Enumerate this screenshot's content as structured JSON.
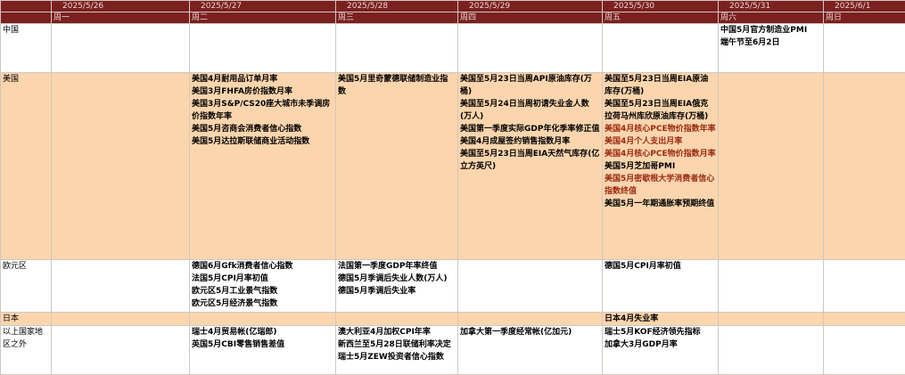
{
  "dates": [
    "2025/5/26",
    "2025/5/27",
    "2025/5/28",
    "2025/5/29",
    "2025/5/30",
    "2025/5/31",
    "2025/6/1"
  ],
  "weekdays": [
    "周一",
    "周二",
    "周三",
    "周四",
    "周五",
    "周六",
    "周日"
  ],
  "rows": [
    {
      "region": "中国",
      "cells": [
        [],
        [],
        [],
        [],
        [],
        [
          {
            "t": "中国5月官方制造业PMI"
          },
          {
            "t": "端午节至6月2日"
          }
        ],
        []
      ]
    },
    {
      "region": "美国",
      "cells": [
        [],
        [
          {
            "t": "美国4月耐用品订单月率"
          },
          {
            "t": "美国3月FHFA房价指数月率"
          },
          {
            "t": "美国3月S&P/CS20座大城市未季调房价指数年率"
          },
          {
            "t": "美国5月咨商会消费者信心指数"
          },
          {
            "t": "美国5月达拉斯联储商业活动指数"
          }
        ],
        [
          {
            "t": "美国5月里奇蒙德联储制造业指数"
          }
        ],
        [
          {
            "t": "美国至5月23日当周API原油库存(万桶)"
          },
          {
            "t": "美国至5月24日当周初请失业金人数(万人)"
          },
          {
            "t": "美国第一季度实际GDP年化季率修正值"
          },
          {
            "t": "美国4月成屋签约销售指数月率"
          },
          {
            "t": "美国至5月23日当周EIA天然气库存(亿立方英尺)"
          }
        ],
        [
          {
            "t": "美国至5月23日当周EIA原油库存(万桶)"
          },
          {
            "t": "美国至5月23日当周EIA俄克拉荷马州库欣原油库存(万桶)"
          },
          {
            "t": "美国4月核心PCE物价指数年率",
            "hl": true
          },
          {
            "t": "美国4月个人支出月率",
            "hl": true
          },
          {
            "t": "美国4月核心PCE物价指数月率",
            "hl": true
          },
          {
            "t": "美国5月芝加哥PMI"
          },
          {
            "t": "美国5月密歇根大学消费者信心指数终值",
            "hl": true
          },
          {
            "t": "美国5月一年期通胀率预期终值"
          }
        ],
        [],
        []
      ]
    },
    {
      "region": "欧元区",
      "cells": [
        [],
        [
          {
            "t": "德国6月Gfk消费者信心指数"
          },
          {
            "t": "法国5月CPI月率初值"
          },
          {
            "t": "欧元区5月工业景气指数"
          },
          {
            "t": "欧元区5月经济景气指数"
          }
        ],
        [
          {
            "t": "法国第一季度GDP年率终值"
          },
          {
            "t": "德国5月季调后失业人数(万人)"
          },
          {
            "t": "德国5月季调后失业率"
          }
        ],
        [],
        [
          {
            "t": "德国5月CPI月率初值"
          }
        ],
        [],
        []
      ]
    },
    {
      "region": "日本",
      "cells": [
        [],
        [],
        [],
        [],
        [
          {
            "t": "日本4月失业率"
          }
        ],
        [],
        []
      ]
    },
    {
      "region": "以上国家地区之外",
      "cells": [
        [],
        [
          {
            "t": "瑞士4月贸易帐(亿瑞郎)"
          },
          {
            "t": "英国5月CBI零售销售差值"
          }
        ],
        [
          {
            "t": "澳大利亚4月加权CPI年率"
          },
          {
            "t": "新西兰至5月28日联储利率决定"
          },
          {
            "t": "瑞士5月ZEW投资者信心指数"
          }
        ],
        [
          {
            "t": "加拿大第一季度经常帐(亿加元)"
          }
        ],
        [
          {
            "t": "瑞士5月KOF经济领先指标"
          },
          {
            "t": "加拿大3月GDP月率"
          }
        ],
        [],
        []
      ]
    }
  ]
}
